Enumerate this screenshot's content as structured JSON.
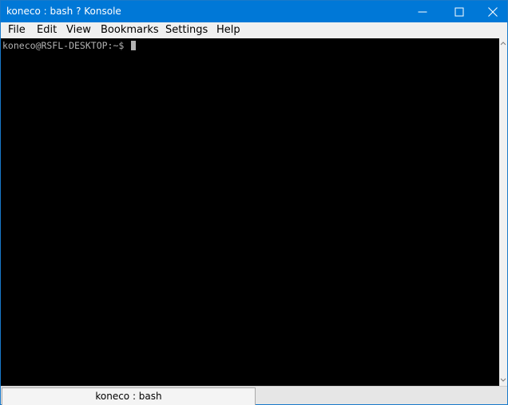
{
  "window": {
    "title": "koneco : bash ? Konsole",
    "controls": {
      "minimize_icon": "minimize-icon",
      "maximize_icon": "maximize-icon",
      "close_icon": "close-icon"
    },
    "titlebar_color": "#0078d7"
  },
  "menubar": {
    "items": [
      {
        "label": "File"
      },
      {
        "label": "Edit"
      },
      {
        "label": "View"
      },
      {
        "label": "Bookmarks"
      },
      {
        "label": "Settings"
      },
      {
        "label": "Help"
      }
    ]
  },
  "terminal": {
    "prompt": "koneco@RSFL-DESKTOP:~$ ",
    "background": "#000000",
    "foreground": "#b2b2b2"
  },
  "tabs": [
    {
      "label": "koneco : bash",
      "active": true
    }
  ]
}
